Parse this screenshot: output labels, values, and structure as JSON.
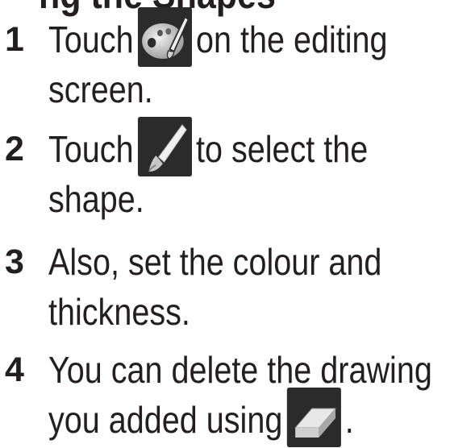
{
  "heading_fragment": "ng the Shapes",
  "steps": [
    {
      "number": "1",
      "line1_before": "Touch",
      "line1_after": "on the editing",
      "line2": "screen.",
      "icon": "palette-icon"
    },
    {
      "number": "2",
      "line1_before": "Touch",
      "line1_after": "to select the",
      "line2": "shape.",
      "icon": "brush-icon"
    },
    {
      "number": "3",
      "line1": "Also, set the colour and",
      "line2": "thickness."
    },
    {
      "number": "4",
      "line1": "You can delete the drawing",
      "line2_before": "you added using",
      "line2_after": ".",
      "icon": "eraser-icon"
    }
  ],
  "colors": {
    "text": "#231f20",
    "icon_background": "#2b2b2b"
  }
}
